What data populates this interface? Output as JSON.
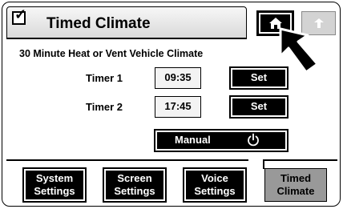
{
  "header": {
    "title": "Timed Climate",
    "checkbox_icon": "checkbox-icon"
  },
  "nav": {
    "home_icon": "home-icon",
    "back_icon": "back-arrow-icon"
  },
  "main": {
    "subtitle": "30 Minute Heat or Vent Vehicle Climate",
    "timers": [
      {
        "label": "Timer 1",
        "value": "09:35",
        "button": "Set"
      },
      {
        "label": "Timer 2",
        "value": "17:45",
        "button": "Set"
      }
    ],
    "manual": {
      "label": "Manual",
      "icon": "power-icon"
    }
  },
  "tabs": [
    {
      "line1": "System",
      "line2": "Settings"
    },
    {
      "line1": "Screen",
      "line2": "Settings"
    },
    {
      "line1": "Voice",
      "line2": "Settings"
    },
    {
      "line1": "Timed",
      "line2": "Climate"
    }
  ]
}
